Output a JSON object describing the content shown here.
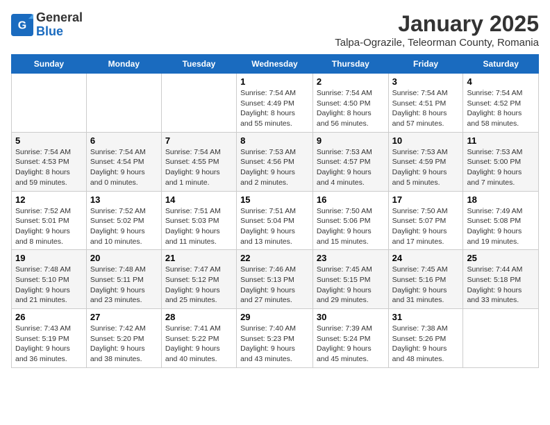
{
  "header": {
    "logo_general": "General",
    "logo_blue": "Blue",
    "month_title": "January 2025",
    "location": "Talpa-Ograzile, Teleorman County, Romania"
  },
  "days_of_week": [
    "Sunday",
    "Monday",
    "Tuesday",
    "Wednesday",
    "Thursday",
    "Friday",
    "Saturday"
  ],
  "weeks": [
    [
      {
        "num": "",
        "info": ""
      },
      {
        "num": "",
        "info": ""
      },
      {
        "num": "",
        "info": ""
      },
      {
        "num": "1",
        "info": "Sunrise: 7:54 AM\nSunset: 4:49 PM\nDaylight: 8 hours\nand 55 minutes."
      },
      {
        "num": "2",
        "info": "Sunrise: 7:54 AM\nSunset: 4:50 PM\nDaylight: 8 hours\nand 56 minutes."
      },
      {
        "num": "3",
        "info": "Sunrise: 7:54 AM\nSunset: 4:51 PM\nDaylight: 8 hours\nand 57 minutes."
      },
      {
        "num": "4",
        "info": "Sunrise: 7:54 AM\nSunset: 4:52 PM\nDaylight: 8 hours\nand 58 minutes."
      }
    ],
    [
      {
        "num": "5",
        "info": "Sunrise: 7:54 AM\nSunset: 4:53 PM\nDaylight: 8 hours\nand 59 minutes."
      },
      {
        "num": "6",
        "info": "Sunrise: 7:54 AM\nSunset: 4:54 PM\nDaylight: 9 hours\nand 0 minutes."
      },
      {
        "num": "7",
        "info": "Sunrise: 7:54 AM\nSunset: 4:55 PM\nDaylight: 9 hours\nand 1 minute."
      },
      {
        "num": "8",
        "info": "Sunrise: 7:53 AM\nSunset: 4:56 PM\nDaylight: 9 hours\nand 2 minutes."
      },
      {
        "num": "9",
        "info": "Sunrise: 7:53 AM\nSunset: 4:57 PM\nDaylight: 9 hours\nand 4 minutes."
      },
      {
        "num": "10",
        "info": "Sunrise: 7:53 AM\nSunset: 4:59 PM\nDaylight: 9 hours\nand 5 minutes."
      },
      {
        "num": "11",
        "info": "Sunrise: 7:53 AM\nSunset: 5:00 PM\nDaylight: 9 hours\nand 7 minutes."
      }
    ],
    [
      {
        "num": "12",
        "info": "Sunrise: 7:52 AM\nSunset: 5:01 PM\nDaylight: 9 hours\nand 8 minutes."
      },
      {
        "num": "13",
        "info": "Sunrise: 7:52 AM\nSunset: 5:02 PM\nDaylight: 9 hours\nand 10 minutes."
      },
      {
        "num": "14",
        "info": "Sunrise: 7:51 AM\nSunset: 5:03 PM\nDaylight: 9 hours\nand 11 minutes."
      },
      {
        "num": "15",
        "info": "Sunrise: 7:51 AM\nSunset: 5:04 PM\nDaylight: 9 hours\nand 13 minutes."
      },
      {
        "num": "16",
        "info": "Sunrise: 7:50 AM\nSunset: 5:06 PM\nDaylight: 9 hours\nand 15 minutes."
      },
      {
        "num": "17",
        "info": "Sunrise: 7:50 AM\nSunset: 5:07 PM\nDaylight: 9 hours\nand 17 minutes."
      },
      {
        "num": "18",
        "info": "Sunrise: 7:49 AM\nSunset: 5:08 PM\nDaylight: 9 hours\nand 19 minutes."
      }
    ],
    [
      {
        "num": "19",
        "info": "Sunrise: 7:48 AM\nSunset: 5:10 PM\nDaylight: 9 hours\nand 21 minutes."
      },
      {
        "num": "20",
        "info": "Sunrise: 7:48 AM\nSunset: 5:11 PM\nDaylight: 9 hours\nand 23 minutes."
      },
      {
        "num": "21",
        "info": "Sunrise: 7:47 AM\nSunset: 5:12 PM\nDaylight: 9 hours\nand 25 minutes."
      },
      {
        "num": "22",
        "info": "Sunrise: 7:46 AM\nSunset: 5:13 PM\nDaylight: 9 hours\nand 27 minutes."
      },
      {
        "num": "23",
        "info": "Sunrise: 7:45 AM\nSunset: 5:15 PM\nDaylight: 9 hours\nand 29 minutes."
      },
      {
        "num": "24",
        "info": "Sunrise: 7:45 AM\nSunset: 5:16 PM\nDaylight: 9 hours\nand 31 minutes."
      },
      {
        "num": "25",
        "info": "Sunrise: 7:44 AM\nSunset: 5:18 PM\nDaylight: 9 hours\nand 33 minutes."
      }
    ],
    [
      {
        "num": "26",
        "info": "Sunrise: 7:43 AM\nSunset: 5:19 PM\nDaylight: 9 hours\nand 36 minutes."
      },
      {
        "num": "27",
        "info": "Sunrise: 7:42 AM\nSunset: 5:20 PM\nDaylight: 9 hours\nand 38 minutes."
      },
      {
        "num": "28",
        "info": "Sunrise: 7:41 AM\nSunset: 5:22 PM\nDaylight: 9 hours\nand 40 minutes."
      },
      {
        "num": "29",
        "info": "Sunrise: 7:40 AM\nSunset: 5:23 PM\nDaylight: 9 hours\nand 43 minutes."
      },
      {
        "num": "30",
        "info": "Sunrise: 7:39 AM\nSunset: 5:24 PM\nDaylight: 9 hours\nand 45 minutes."
      },
      {
        "num": "31",
        "info": "Sunrise: 7:38 AM\nSunset: 5:26 PM\nDaylight: 9 hours\nand 48 minutes."
      },
      {
        "num": "",
        "info": ""
      }
    ]
  ]
}
